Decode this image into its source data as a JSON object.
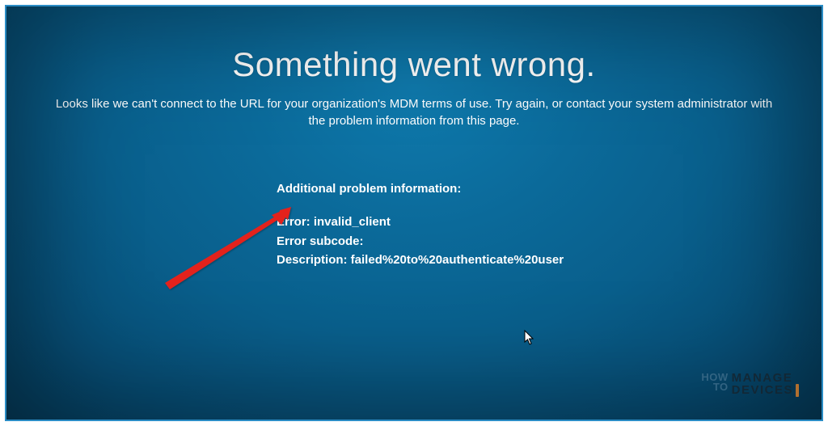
{
  "error_screen": {
    "title": "Something went wrong.",
    "subtitle": "Looks like we can't connect to the URL for your organization's MDM terms of use. Try again, or contact your system administrator with the problem information from this page.",
    "details_header": "Additional problem information:",
    "error_line": "Error: invalid_client",
    "subcode_line": "Error subcode:",
    "description_line": "Description: failed%20to%20authenticate%20user"
  },
  "watermark": {
    "how": "HOW",
    "to": "TO",
    "manage": "MANAGE",
    "devices": "DEVICES"
  },
  "annotation": {
    "arrow_color": "#e3221f"
  }
}
